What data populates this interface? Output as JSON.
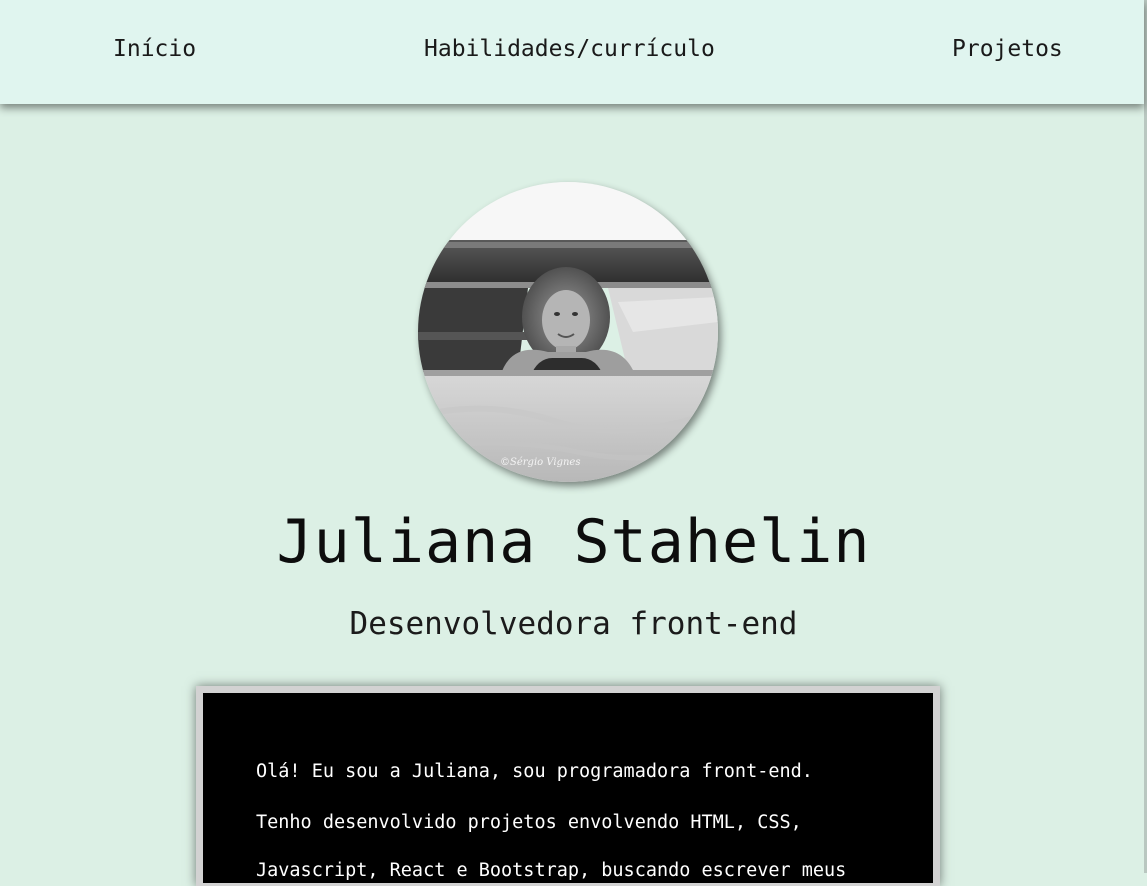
{
  "nav": {
    "items": [
      {
        "label": "Início"
      },
      {
        "label": "Habilidades/currículo"
      },
      {
        "label": "Projetos"
      }
    ]
  },
  "profile": {
    "name": "Juliana Stahelin",
    "role": "Desenvolvedora front-end",
    "photo_watermark": "©Sérgio Vignes"
  },
  "about": {
    "lines": [
      "Olá! Eu sou a Juliana, sou programadora front-end.",
      "Tenho desenvolvido projetos envolvendo HTML, CSS,",
      "Javascript, React e Bootstrap, buscando escrever meus"
    ]
  },
  "colors": {
    "page_background": "#dcf0e5",
    "navbar_background": "#e0f5ef",
    "terminal_background": "#000000",
    "terminal_frame": "#d2d2d2"
  }
}
